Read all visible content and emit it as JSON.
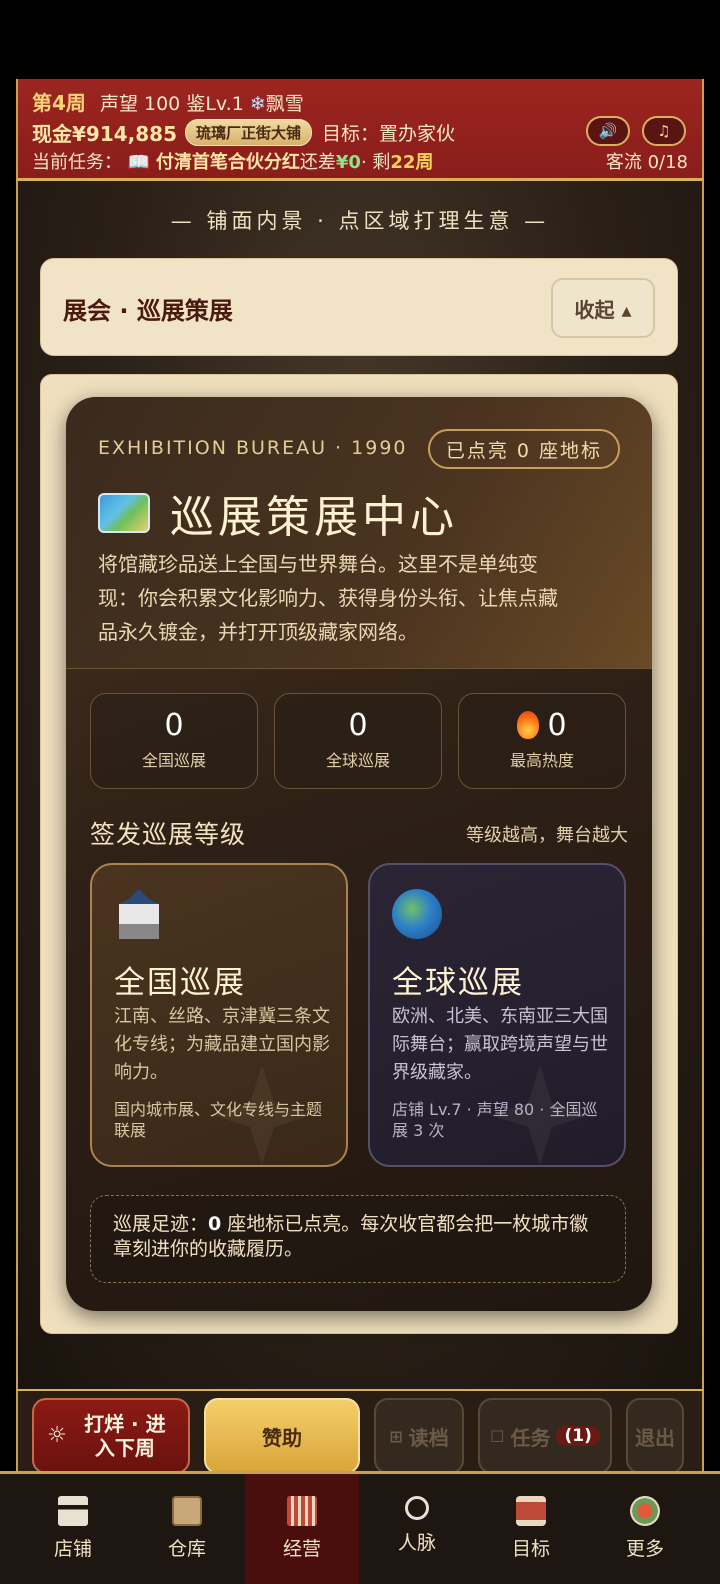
{
  "header": {
    "week": "第4周",
    "reputation": "声望 100",
    "appraisal": "鉴Lv.1",
    "weather_icon": "❄",
    "weather": "飘雪",
    "cash": "现金¥914,885",
    "shop_name": "琉璃厂正街大铺",
    "goal": "目标：置办家伙",
    "task_prefix": "当前任务：",
    "task_icon": "📖",
    "task_name": "付清首笔合伙分红",
    "task_remain": "还差",
    "task_amount": "¥0",
    "task_dot": "· 剩",
    "task_weeks": "22周",
    "traffic": "客流 0/18",
    "sound_icon": "🔊",
    "music_icon": "♫"
  },
  "main": {
    "section_title": "— 铺面内景 · 点区域打理生意 —",
    "panel_title": "展会 · 巡展策展",
    "collapse_label": "收起 ▴",
    "card": {
      "bureau": "EXHIBITION BUREAU · 1990",
      "lit_badge": "已点亮 0 座地标",
      "title": "巡展策展中心",
      "description": "将馆藏珍品送上全国与世界舞台。这里不是单纯变现：你会积累文化影响力、获得身份头衔、让焦点藏品永久镀金，并打开顶级藏家网络。",
      "stats": [
        {
          "value": "0",
          "label": "全国巡展"
        },
        {
          "value": "0",
          "label": "全球巡展"
        },
        {
          "value": "0",
          "label": "最高热度"
        }
      ],
      "level_title": "签发巡展等级",
      "level_sub": "等级越高，舞台越大",
      "tiers": [
        {
          "name": "全国巡展",
          "desc": "江南、丝路、京津冀三条文化专线；为藏品建立国内影响力。",
          "req": "国内城市展、文化专线与主题联展"
        },
        {
          "name": "全球巡展",
          "desc": "欧洲、北美、东南亚三大国际舞台；赢取跨境声望与世界级藏家。",
          "req": "店铺 Lv.7 · 声望 80 · 全国巡展 3 次"
        }
      ],
      "footprint_prefix": "巡展足迹：",
      "footprint_count": "0",
      "footprint_text": " 座地标已点亮。每次收官都会把一枚城市徽章刻进你的收藏履历。"
    }
  },
  "actions": {
    "go_icon": "☼",
    "go_label": "打烊 · 进入下周",
    "sponsor": "赞助",
    "load": "读档",
    "task": "任务",
    "task_count": "(1)",
    "exit": "退出"
  },
  "tabs": [
    {
      "label": "店铺",
      "icon": "shop-icon"
    },
    {
      "label": "仓库",
      "icon": "box-icon"
    },
    {
      "label": "经营",
      "icon": "ledger-icon"
    },
    {
      "label": "人脉",
      "icon": "people-icon"
    },
    {
      "label": "目标",
      "icon": "scroll-icon"
    },
    {
      "label": "更多",
      "icon": "more-icon"
    }
  ],
  "active_tab": "经营"
}
